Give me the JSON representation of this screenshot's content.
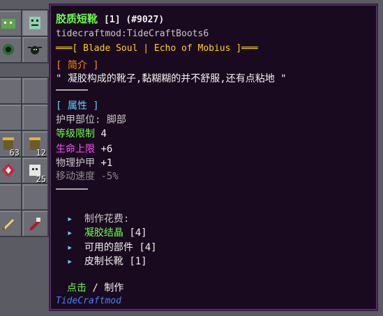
{
  "inventory": {
    "slots": [
      {
        "icon": "slime-icon",
        "count": ""
      },
      {
        "icon": "robot-icon",
        "count": ""
      },
      {
        "icon": "green-wisp-icon",
        "count": ""
      },
      {
        "icon": "spider-icon",
        "count": ""
      },
      {
        "icon": "gold-pot-icon",
        "count": "63"
      },
      {
        "icon": "gold-pot-icon",
        "count": "12"
      },
      {
        "icon": "red-gem-icon",
        "count": ""
      },
      {
        "icon": "ghost-icon",
        "count": "25"
      },
      {
        "icon": "sword-icon",
        "count": ""
      },
      {
        "icon": "red-sword-icon",
        "count": ""
      }
    ]
  },
  "tooltip": {
    "item_name": "胶质短靴",
    "item_meta": "[1] (#9027)",
    "mod_item_id": "tidecraftmod:TideCraftBoots6",
    "tag_line": "═══[ Blade Soul | Echo of Mobius ]═══",
    "intro_header": "[ 简介 ]",
    "intro_text": "\" 凝胶构成的靴子,黏糊糊的并不舒服,还有点粘地 \"",
    "attr_header": "[ 属性 ]",
    "armor_slot": "护甲部位: 脚部",
    "level_label": "等级限制",
    "level_value": "4",
    "hp_label": "生命上限",
    "hp_value": "+6",
    "defense_label": "物理护甲",
    "defense_value": "+1",
    "speed_label": "移动速度",
    "speed_value": "-5%",
    "craft_title": "制作花费:",
    "craft_items": [
      {
        "name": "凝胶结晶",
        "count": "[4]"
      },
      {
        "name": "可用的部件",
        "count": "[4]"
      },
      {
        "name": "皮制长靴",
        "count": "[1]"
      }
    ],
    "craft_action_key": "点击",
    "craft_action_sep": " / ",
    "craft_action_label": "制作",
    "mod_name": "TideCraftmod"
  },
  "colors": {
    "tooltip_bg": "#1a0a1f",
    "name_green": "#6bff4a",
    "gold": "#ffd400",
    "orange": "#ff8a00",
    "cyan": "#5fd3ff",
    "magenta": "#ff4dff",
    "mod_blue": "#4b7dff"
  }
}
